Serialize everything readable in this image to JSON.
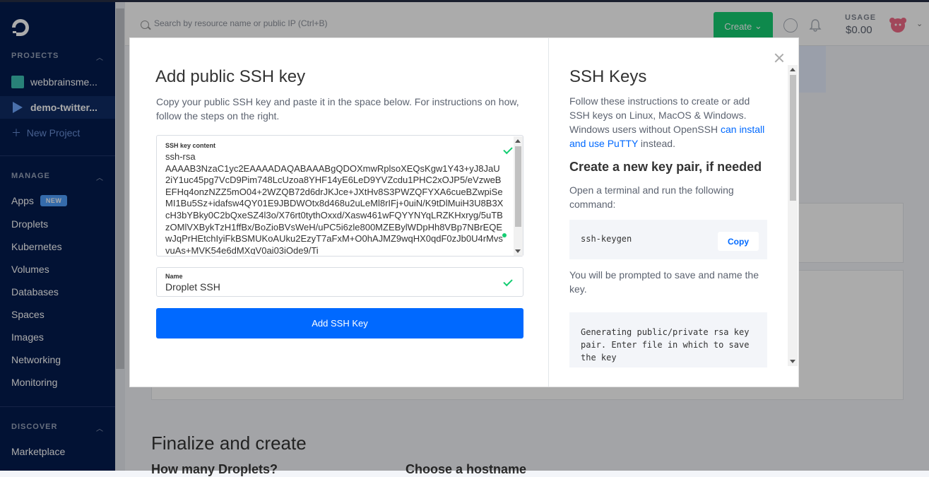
{
  "sidebar": {
    "projects_heading": "PROJECTS",
    "projects": [
      {
        "label": "webbrainsme..."
      },
      {
        "label": "demo-twitter..."
      }
    ],
    "new_project": "New Project",
    "manage_heading": "MANAGE",
    "apps": {
      "label": "Apps",
      "badge": "NEW"
    },
    "items": [
      {
        "label": "Droplets"
      },
      {
        "label": "Kubernetes"
      },
      {
        "label": "Volumes"
      },
      {
        "label": "Databases"
      },
      {
        "label": "Spaces"
      },
      {
        "label": "Images"
      },
      {
        "label": "Networking"
      },
      {
        "label": "Monitoring"
      }
    ],
    "discover_heading": "DISCOVER",
    "marketplace": "Marketplace"
  },
  "header": {
    "search_placeholder": "Search by resource name or public IP (Ctrl+B)",
    "create_label": "Create",
    "usage_label": "USAGE",
    "usage_value": "$0.00"
  },
  "background": {
    "finalize_title": "Finalize and create",
    "how_many": "How many Droplets?",
    "hostname": "Choose a hostname"
  },
  "modal": {
    "title": "Add public SSH key",
    "description": "Copy your public SSH key and paste it in the space below. For instructions on how, follow the steps on the right.",
    "key_label": "SSH key content",
    "key_value": "ssh-rsa\nAAAAB3NzaC1yc2EAAAADAQABAAABgQDOXmwRplsoXEQsKgw1Y43+yJ8JaU2iY1uc45pg7VcD9Pim748LcUzoa8YHF14yE6LeD9YVZcdu1PHC2xOJP5/eVzweBEFHq4onzNZZ5mO04+2WZQB72d6drJKJce+JXtHv8S3PWZQFYXA6cueBZwpiSeMI1Bu5Sz+idafsw4QY01E9JBDWOtx8d468u2uLeMl8rIFj+0uiN/K9tDlMuiH3U8B3XcH3bYBky0C2bQxeSZ4l3o/X76rt0tythOxxd/Xasw461wFQYYNYqLRZKHxryg/5uTBzOMlVXBykTzH1ffBx/BoZioBVsWeH/uPC5i6zle800MZEBylWDpHh8VBp7NBrEQEwJqPrHEtchIyiFkBSMUKoAUku2EzyT7aFxM+O0hAJMZ9wqHX0qdF0zJb0U4rMvsvuAs+MVK54e6dMXqV0ai03iOde9/Ti",
    "name_label": "Name",
    "name_value": "Droplet SSH",
    "add_button": "Add SSH Key",
    "right": {
      "title": "SSH Keys",
      "intro_pre": "Follow these instructions to create or add SSH keys on Linux, MacOS & Windows. Windows users without OpenSSH ",
      "intro_link": "can install and use PuTTY",
      "intro_post": " instead.",
      "subtitle": "Create a new key pair, if needed",
      "step1": "Open a terminal and run the following command:",
      "code1": "ssh-keygen",
      "copy_label": "Copy",
      "step2": "You will be prompted to save and name the key.",
      "code2": "Generating public/private rsa key pair. Enter file in which to save the key"
    }
  },
  "colors": {
    "sidebar": "#031b4e",
    "primary": "#0069ff",
    "success": "#15cd72"
  }
}
